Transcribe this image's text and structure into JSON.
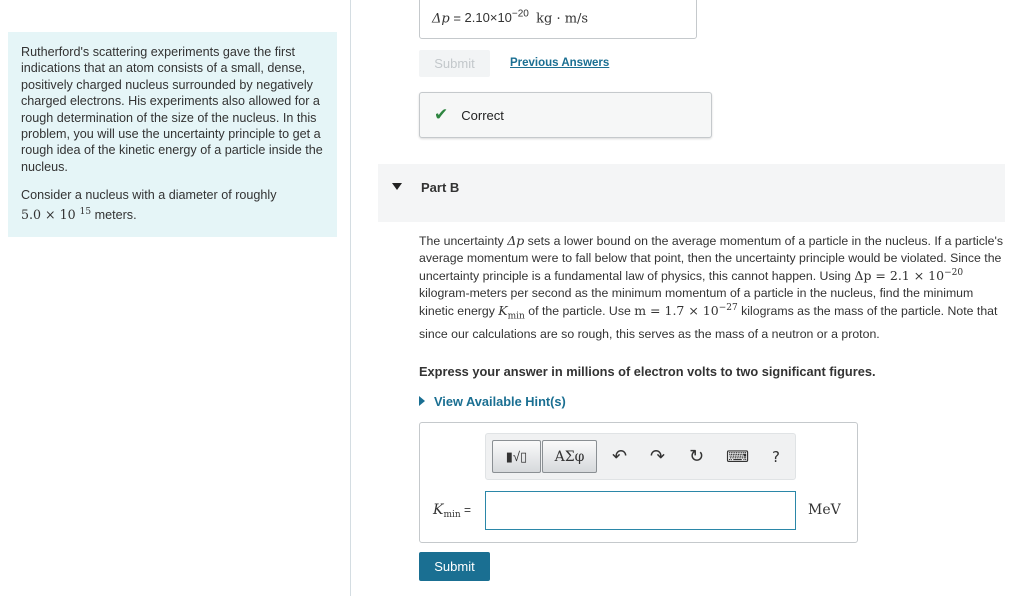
{
  "intro": {
    "paragraph1": "Rutherford's scattering experiments gave the first indications that an atom consists of a small, dense, positively charged nucleus surrounded by negatively charged electrons. His experiments also allowed for a rough determination of the size of the nucleus. In this problem, you will use the uncertainty principle to get a rough idea of the kinetic energy of a particle inside the nucleus.",
    "paragraph2_text": "Consider a nucleus with a diameter of roughly",
    "paragraph2_value": "5.0 × 10",
    "paragraph2_exp": "15",
    "paragraph2_unit": " meters."
  },
  "part_a": {
    "answer_symbol": "Δp",
    "answer_eq": " = ",
    "answer_value": "2.10×10",
    "answer_exp": "−20",
    "answer_unit": "kg · m/s",
    "submit_label": "Submit",
    "previous_answers_label": "Previous Answers",
    "correct_label": "Correct"
  },
  "part_b": {
    "title": "Part B",
    "problem_html_pieces": {
      "t1": "The uncertainty ",
      "m1": "Δp",
      "t2": " sets a lower bound on the average momentum of a particle in the nucleus. If a particle's average momentum were to fall below that point, then the uncertainty principle would be violated. Since the uncertainty principle is a fundamental law of physics, this cannot happen. Using ",
      "m2": "Δp = 2.1 × 10",
      "m2exp": "−20",
      "t3": " kilogram-meters per second as the minimum momentum of a particle in the nucleus, find the minimum kinetic energy ",
      "m3": "K",
      "m3sub": "min",
      "t4": " of the particle. Use ",
      "m4": "m = 1.7 × 10",
      "m4exp": "−27",
      "t5": " kilograms as the mass of the particle. Note that since our calculations are so rough, this serves as the mass of a neutron or a proton."
    },
    "express_label": "Express your answer in millions of electron volts to two significant figures.",
    "hint_label": "View Available Hint(s)",
    "toolbar": {
      "templates_label": "▮√▯",
      "symbols_label": "ΑΣφ",
      "undo": "↶",
      "redo": "↷",
      "reset": "↻",
      "keyboard": "⌨",
      "help": "?"
    },
    "input_label_main": "K",
    "input_label_sub": "min",
    "input_label_eq": " =",
    "input_value": "",
    "unit": "MeV",
    "submit_label": "Submit"
  }
}
